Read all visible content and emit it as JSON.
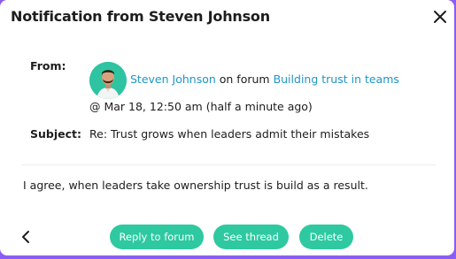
{
  "dialog": {
    "title": "Notification from Steven Johnson",
    "close_icon": "close-icon"
  },
  "from": {
    "label": "From:",
    "sender_name": "Steven Johnson",
    "on_forum_text": " on forum ",
    "forum_name": "Building trust in teams",
    "timestamp": "@ Mar 18, 12:50 am (half a minute ago)"
  },
  "subject": {
    "label": "Subject:",
    "value": "Re: Trust grows when leaders admit their mistakes"
  },
  "message": {
    "body": "I agree, when leaders take ownership trust is build as a result."
  },
  "actions": {
    "back_icon": "chevron-left-icon",
    "reply_label": "Reply to forum",
    "thread_label": "See thread",
    "delete_label": "Delete"
  },
  "colors": {
    "accent": "#2ec9a0",
    "link": "#1e96c8",
    "text": "#1d1d1f",
    "background": "#8a5cf6"
  }
}
